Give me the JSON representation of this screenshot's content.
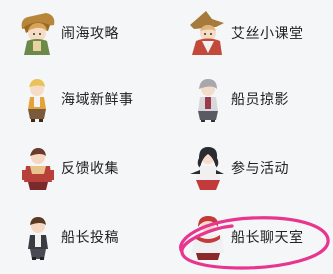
{
  "menu": {
    "items": [
      {
        "label": "闹海攻略",
        "icon": "adventurer-girl-icon"
      },
      {
        "label": "艾丝小课堂",
        "icon": "witch-hat-girl-icon"
      },
      {
        "label": "海域新鲜事",
        "icon": "blonde-chibi-icon"
      },
      {
        "label": "船员掠影",
        "icon": "gray-hair-chibi-icon"
      },
      {
        "label": "反馈收集",
        "icon": "red-outfit-chibi-icon"
      },
      {
        "label": "参与活动",
        "icon": "dark-hair-dancer-icon"
      },
      {
        "label": "船长投稿",
        "icon": "brown-hair-chibi-icon"
      },
      {
        "label": "船长聊天室",
        "icon": "red-hair-captain-icon"
      }
    ]
  },
  "highlight": {
    "color": "#e8358f",
    "target": "船长聊天室"
  },
  "colors": {
    "background": "#f5f6f8",
    "text": "#222222"
  }
}
